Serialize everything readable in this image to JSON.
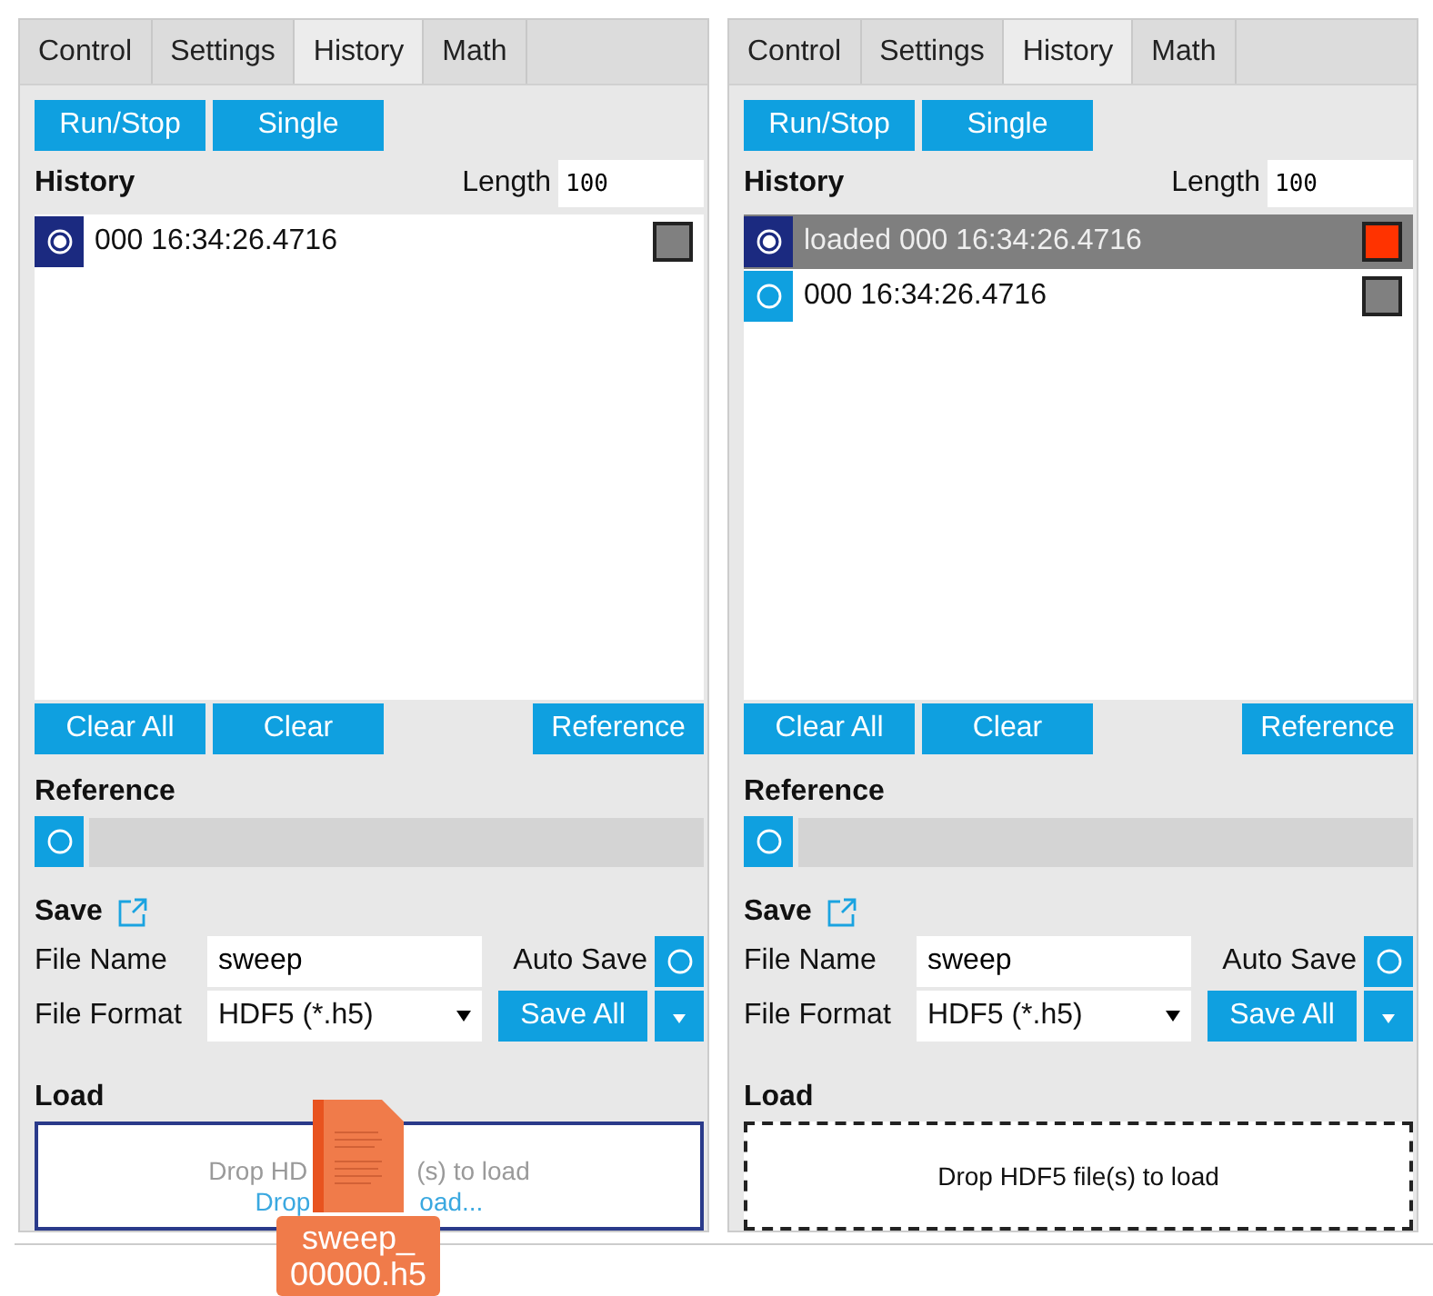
{
  "panels": [
    {
      "tabs": [
        {
          "label": "Control",
          "selected": false
        },
        {
          "label": "Settings",
          "selected": false
        },
        {
          "label": "History",
          "selected": true
        },
        {
          "label": "Math",
          "selected": false
        }
      ],
      "run_buttons": [
        "Run/Stop",
        "Single"
      ],
      "history_title": "History",
      "length_label": "Length",
      "length_value": "100",
      "entries": [
        {
          "label": "000 16:34:26.4716",
          "checked": true,
          "highlighted": false,
          "color": "#808080"
        }
      ],
      "list_buttons": [
        "Clear All",
        "Clear"
      ],
      "reference_button": "Reference",
      "reference_title": "Reference",
      "reference_checked": false,
      "save_title": "Save",
      "file_name_label": "File Name",
      "file_name_value": "sweep",
      "auto_save_label": "Auto Save",
      "auto_save": false,
      "file_format_label": "File Format",
      "file_format_value": "HDF5 (*.h5)",
      "save_all_label": "Save All",
      "load_title": "Load",
      "drop": {
        "drag_over": true,
        "hint_parts": [
          "Drop HD",
          "(s) to load"
        ],
        "link_parts": [
          "Drop",
          "oad..."
        ],
        "dragged_file": {
          "label_lines": [
            "sweep_",
            "00000.h5"
          ]
        }
      }
    },
    {
      "tabs": [
        {
          "label": "Control",
          "selected": false
        },
        {
          "label": "Settings",
          "selected": false
        },
        {
          "label": "History",
          "selected": true
        },
        {
          "label": "Math",
          "selected": false
        }
      ],
      "run_buttons": [
        "Run/Stop",
        "Single"
      ],
      "history_title": "History",
      "length_label": "Length",
      "length_value": "100",
      "entries": [
        {
          "label": "loaded 000 16:34:26.4716",
          "checked": true,
          "highlighted": true,
          "color": "#ff3300"
        },
        {
          "label": "000 16:34:26.4716",
          "checked": false,
          "highlighted": false,
          "color": "#808080"
        }
      ],
      "list_buttons": [
        "Clear All",
        "Clear"
      ],
      "reference_button": "Reference",
      "reference_title": "Reference",
      "reference_checked": false,
      "save_title": "Save",
      "file_name_label": "File Name",
      "file_name_value": "sweep",
      "auto_save_label": "Auto Save",
      "auto_save": false,
      "file_format_label": "File Format",
      "file_format_value": "HDF5 (*.h5)",
      "save_all_label": "Save All",
      "load_title": "Load",
      "drop": {
        "drag_over": false,
        "hint_parts": [
          "Drop HDF5 file(s) to load"
        ]
      }
    }
  ]
}
